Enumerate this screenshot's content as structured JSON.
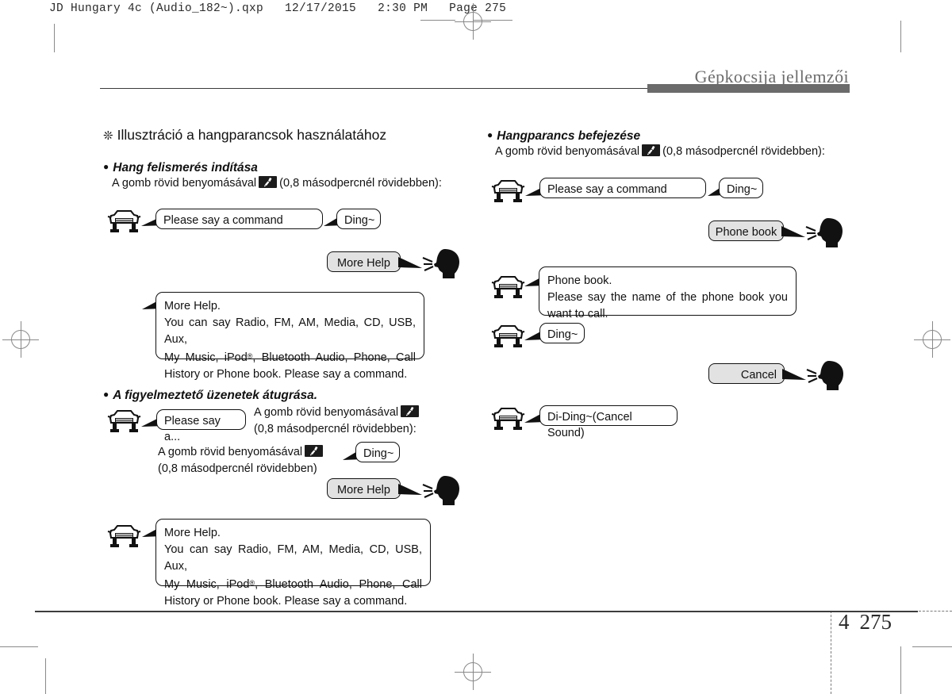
{
  "print_header": "JD Hungary 4c (Audio_182~).qxp   12/17/2015   2:30 PM   Page 275",
  "chapter_title": "Gépkocsija jellemzői",
  "footer": {
    "section_number": "4",
    "page_number": "275"
  },
  "left_column": {
    "section_heading": {
      "marker": "❊",
      "text": "Illusztráció a hangparancsok használatához"
    },
    "blocks": [
      {
        "bullet": "Hang felismerés indítása",
        "instruction_before": "A gomb rövid benyomásával",
        "instruction_after": "(0,8 másodpercnél rövidebben):",
        "bubbles": [
          {
            "name": "please-say-a-command",
            "text": "Please say a command"
          },
          {
            "name": "ding",
            "text": "Ding~"
          },
          {
            "name": "more-help-spoken",
            "text": "More Help"
          }
        ],
        "help_box": {
          "line1": "More Help.",
          "line2": "You can say Radio, FM, AM, Media, CD, USB, Aux,",
          "line3": "My Music, iPod®, Bluetooth Audio, Phone, Call",
          "line4": "History or Phone book. Please say a command."
        }
      },
      {
        "bullet": "A figyelmeztető üzenetek átugrása.",
        "bubble_truncated": "Please say a...",
        "instruction_1_line1": "A gomb rövid benyomásával",
        "instruction_1_line2": "(0,8 másodpercnél rövidebben):",
        "instruction_2_line1": "A gomb rövid benyomásával",
        "instruction_2_line2": "(0,8 másodpercnél rövidebben)",
        "bubble_ding": "Ding~",
        "bubble_more_help": "More Help",
        "help_box": {
          "line1": "More Help.",
          "line2": "You can say Radio, FM, AM, Media, CD, USB, Aux,",
          "line3": "My Music, iPod®, Bluetooth Audio, Phone, Call",
          "line4": "History or Phone book. Please say a command."
        }
      }
    ]
  },
  "right_column": {
    "bullet": "Hangparancs befejezése",
    "instruction_before": "A gomb rövid benyomásával",
    "instruction_after": "(0,8 másodpercnél rövidebben):",
    "bubbles": {
      "please_say_a_command": "Please say a command",
      "ding_1": "Ding~",
      "phone_book_spoken": "Phone book",
      "phone_book_prompt_line1": "Phone book.",
      "phone_book_prompt_line2": "Please say the name of the phone book you",
      "phone_book_prompt_line3": "want to call.",
      "ding_2": "Ding~",
      "cancel_spoken": "Cancel",
      "di_ding": "Di-Ding~(Cancel Sound)"
    }
  },
  "icons": {
    "car": "car-front-icon",
    "head": "speaking-head-icon",
    "voice_button": "voice-command-button-icon",
    "registration_mark": "registration-mark-icon"
  }
}
